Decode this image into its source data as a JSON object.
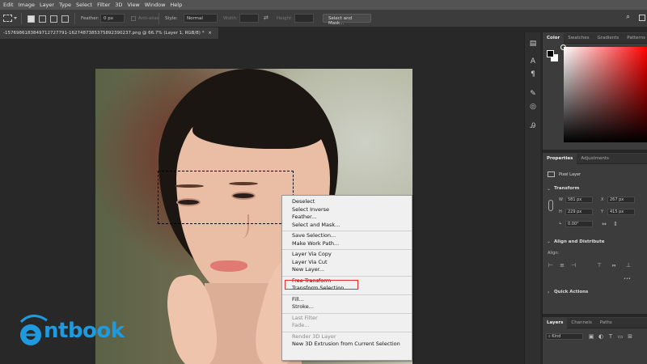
{
  "menubar": {
    "items": [
      "Edit",
      "Image",
      "Layer",
      "Type",
      "Select",
      "Filter",
      "3D",
      "View",
      "Window",
      "Help"
    ]
  },
  "options": {
    "feather_label": "Feather:",
    "feather_value": "0 px",
    "antialias_label": "Anti-alias",
    "style_label": "Style:",
    "style_value": "Normal",
    "width_label": "Width:",
    "height_label": "Height:",
    "select_mask_button": "Select and Mask..."
  },
  "document": {
    "tab_title": "-1576986183849712727791-1627487385375892390237.png @ 66.7% (Layer 1, RGB/8) *",
    "close_glyph": "×"
  },
  "context_menu": {
    "groups": [
      [
        "Deselect",
        "Select Inverse",
        "Feather...",
        "Select and Mask..."
      ],
      [
        "Save Selection...",
        "Make Work Path..."
      ],
      [
        "Layer Via Copy",
        "Layer Via Cut",
        "New Layer..."
      ],
      [
        "Free Transform",
        "Transform Selection"
      ],
      [
        "Fill...",
        "Stroke..."
      ],
      [
        "Last Filter",
        "Fade..."
      ],
      [
        "Render 3D Layer",
        "New 3D Extrusion from Current Selection"
      ]
    ],
    "disabled": [
      "Last Filter",
      "Fade...",
      "Render 3D Layer"
    ],
    "highlighted": "Free Transform",
    "highlight_color": "#e03030"
  },
  "panels": {
    "color_tabs": [
      "Color",
      "Swatches",
      "Gradients",
      "Patterns"
    ],
    "properties_tabs": [
      "Properties",
      "Adjustments"
    ],
    "layer_type": "Pixel Layer",
    "transform_label": "Transform",
    "w_label": "W",
    "w_value": "581 px",
    "x_label": "X",
    "x_value": "267 px",
    "h_label": "H",
    "h_value": "229 px",
    "y_label": "Y",
    "y_value": "415 px",
    "angle_value": "0.00°",
    "align_label": "Align and Distribute",
    "align_sub": "Align:",
    "quick_actions": "Quick Actions",
    "layers_tabs": [
      "Layers",
      "Channels",
      "Paths"
    ],
    "kind_label": "Kind",
    "more_glyph": "•••"
  },
  "logo": {
    "text": "ntbook",
    "color": "#1e9be0"
  },
  "colors": {
    "menubar_bg": "#535353",
    "workspace_bg": "#282828",
    "panel_bg": "#3c3c3c"
  }
}
